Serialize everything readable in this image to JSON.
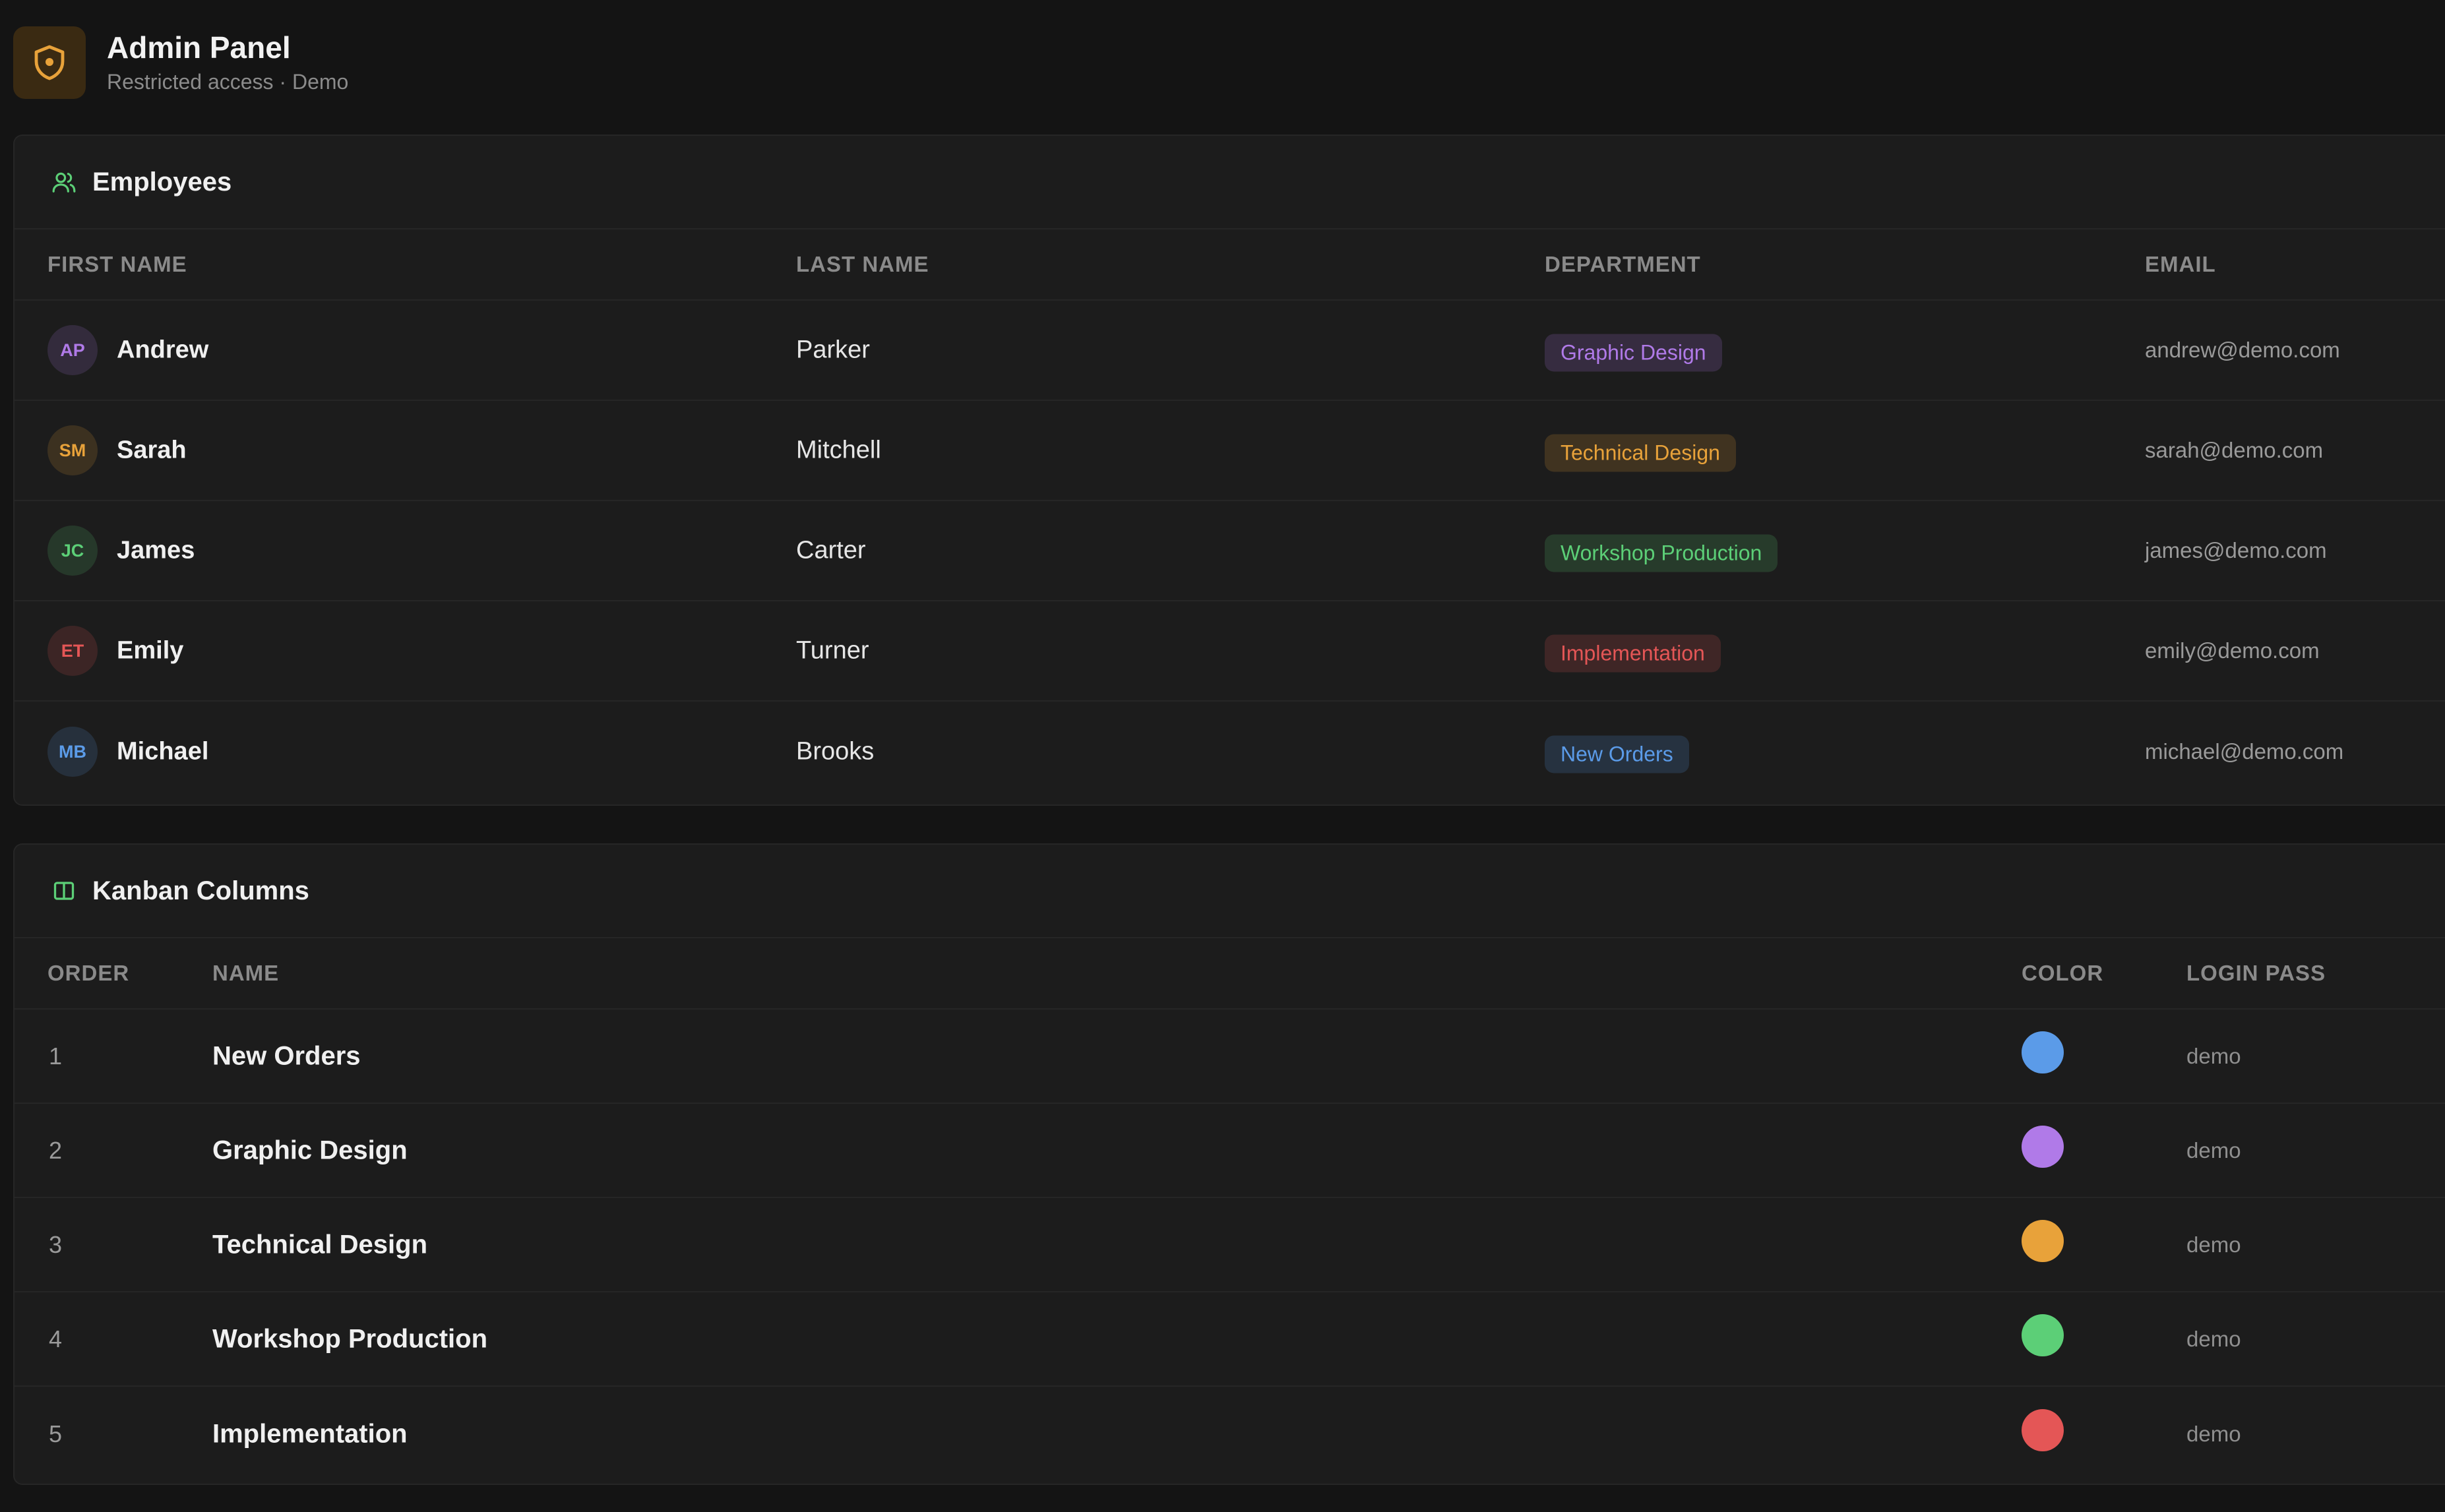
{
  "header": {
    "title": "Admin Panel",
    "subtitle": "Restricted access · Demo",
    "logo_icon": "shield-icon",
    "accent": "#e8a23a"
  },
  "employees": {
    "title": "Employees",
    "icon": "users-icon",
    "columns": {
      "first_name": "FIRST NAME",
      "last_name": "LAST NAME",
      "department": "DEPARTMENT",
      "email": "EMAIL"
    },
    "rows": [
      {
        "initials": "AP",
        "first": "Andrew",
        "last": "Parker",
        "department": "Graphic Design",
        "email": "andrew@demo.com",
        "color": "#b07ae8"
      },
      {
        "initials": "SM",
        "first": "Sarah",
        "last": "Mitchell",
        "department": "Technical Design",
        "email": "sarah@demo.com",
        "color": "#e8a23a"
      },
      {
        "initials": "JC",
        "first": "James",
        "last": "Carter",
        "department": "Workshop Production",
        "email": "james@demo.com",
        "color": "#5ccf77"
      },
      {
        "initials": "ET",
        "first": "Emily",
        "last": "Turner",
        "department": "Implementation",
        "email": "emily@demo.com",
        "color": "#e45656"
      },
      {
        "initials": "MB",
        "first": "Michael",
        "last": "Brooks",
        "department": "New Orders",
        "email": "michael@demo.com",
        "color": "#5b9be8"
      }
    ]
  },
  "kanban": {
    "title": "Kanban Columns",
    "icon": "columns-icon",
    "columns": {
      "order": "ORDER",
      "name": "NAME",
      "color": "COLOR",
      "login_pass": "LOGIN PASS"
    },
    "rows": [
      {
        "order": "1",
        "name": "New Orders",
        "color": "#5b9be8",
        "pass": "demo"
      },
      {
        "order": "2",
        "name": "Graphic Design",
        "color": "#b07ae8",
        "pass": "demo"
      },
      {
        "order": "3",
        "name": "Technical Design",
        "color": "#e8a23a",
        "pass": "demo"
      },
      {
        "order": "4",
        "name": "Workshop Production",
        "color": "#5ccf77",
        "pass": "demo"
      },
      {
        "order": "5",
        "name": "Implementation",
        "color": "#e45656",
        "pass": "demo"
      }
    ]
  }
}
